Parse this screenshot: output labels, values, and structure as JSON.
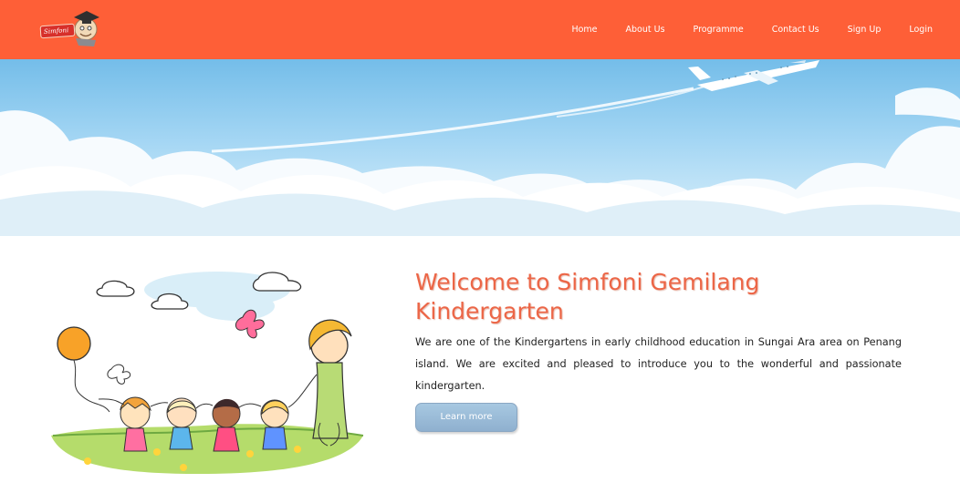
{
  "nav": {
    "logo_text": "Simfoni",
    "links": [
      "Home",
      "About Us",
      "Programme",
      "Contact Us",
      "Sign Up",
      "Login"
    ]
  },
  "main": {
    "title": "Welcome to Simfoni Gemilang Kindergarten",
    "description": "We are one of the Kindergartens in early childhood education in Sungai Ara area on Penang island. We are excited and pleased to introduce you to the wonderful and passionate kindergarten.",
    "button_label": "Learn more"
  },
  "colors": {
    "navbar": "#fe5f37",
    "title": "#ec6647",
    "button": "#9dbfdc"
  }
}
